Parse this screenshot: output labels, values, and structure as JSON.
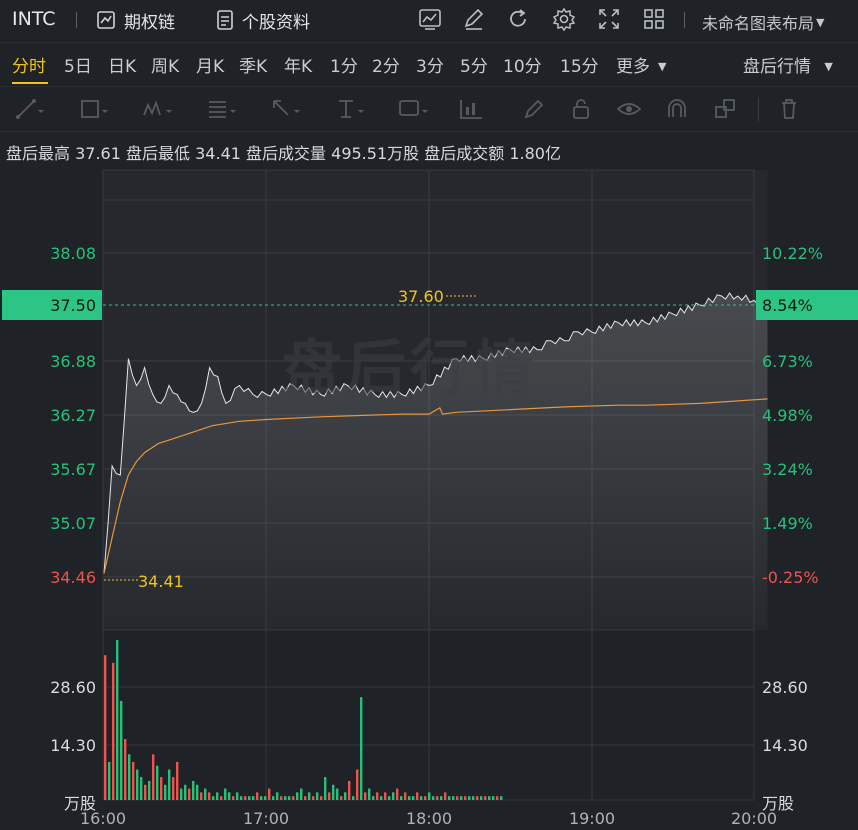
{
  "header": {
    "ticker": "INTC",
    "options_chain": "期权链",
    "stock_profile": "个股资料",
    "layout_name": "未命名图表布局"
  },
  "tabs": [
    "分时",
    "5日",
    "日K",
    "周K",
    "月K",
    "季K",
    "年K",
    "1分",
    "2分",
    "3分",
    "5分",
    "10分",
    "15分",
    "更多"
  ],
  "active_tab": "分时",
  "after_hours_menu": "盘后行情",
  "stats": {
    "high_label": "盘后最高",
    "high_value": "37.61",
    "low_label": "盘后最低",
    "low_value": "34.41",
    "volume_label": "盘后成交量",
    "volume_value": "495.51万股",
    "turnover_label": "盘后成交额",
    "turnover_value": "1.80亿"
  },
  "watermark": "盘后行情",
  "colors": {
    "up": "#27c27a",
    "down": "#f0524e",
    "current": "#2dc585",
    "avg_line": "#e8963c",
    "price_line": "#e6e6e6",
    "highlight": "#f3c21b"
  },
  "chart_data": {
    "type": "line",
    "title": "",
    "x_ticks": [
      "16:00",
      "17:00",
      "18:00",
      "19:00",
      "20:00"
    ],
    "price_axis_left": [
      "38.08",
      "36.88",
      "36.27",
      "35.67",
      "35.07",
      "34.46"
    ],
    "pct_axis_right": [
      "10.22%",
      "6.73%",
      "4.98%",
      "3.24%",
      "1.49%",
      "-0.25%"
    ],
    "current_price": "37.50",
    "current_pct": "8.54%",
    "high_marker": "37.60",
    "low_marker": "34.41",
    "ylim": [
      34.46,
      38.08
    ],
    "volume_ticks": [
      "28.60",
      "14.30"
    ],
    "volume_unit": "万股",
    "price_series": {
      "name": "price",
      "time_minutes": [
        0,
        3,
        6,
        9,
        12,
        15,
        18,
        21,
        24,
        27,
        30,
        33,
        36,
        39,
        42,
        45,
        50,
        55,
        60,
        70,
        80,
        90,
        100,
        110,
        120,
        130,
        140,
        150,
        160,
        165,
        170,
        175,
        180,
        190,
        200,
        210,
        220,
        228,
        234,
        240,
        245
      ],
      "values": [
        34.5,
        35.7,
        35.6,
        36.9,
        36.6,
        36.8,
        36.5,
        36.4,
        36.6,
        36.5,
        36.4,
        36.3,
        36.4,
        36.8,
        36.7,
        36.4,
        36.6,
        36.5,
        36.5,
        36.6,
        36.5,
        36.6,
        36.5,
        36.5,
        36.6,
        36.9,
        36.9,
        37.0,
        37.0,
        37.1,
        37.1,
        37.2,
        37.2,
        37.3,
        37.3,
        37.4,
        37.5,
        37.6,
        37.6,
        37.55,
        37.5
      ]
    },
    "avg_series": {
      "name": "avg",
      "time_minutes": [
        0,
        3,
        6,
        9,
        12,
        15,
        20,
        25,
        30,
        35,
        40,
        50,
        60,
        80,
        100,
        110,
        120,
        124,
        125,
        130,
        150,
        170,
        190,
        200,
        210,
        220,
        230,
        245
      ],
      "values": [
        34.5,
        34.9,
        35.3,
        35.6,
        35.75,
        35.85,
        35.95,
        36.0,
        36.05,
        36.1,
        36.15,
        36.2,
        36.22,
        36.25,
        36.27,
        36.28,
        36.28,
        36.35,
        36.28,
        36.3,
        36.33,
        36.36,
        36.38,
        36.38,
        36.39,
        36.4,
        36.42,
        36.45
      ]
    },
    "volume_series": {
      "name": "volume",
      "values": [
        38,
        10,
        36,
        42,
        26,
        16,
        12,
        10,
        8,
        6,
        4,
        5,
        12,
        9,
        6,
        4,
        8,
        6,
        10,
        3,
        4,
        3,
        5,
        4,
        2,
        3,
        2,
        1,
        2,
        1,
        3,
        2,
        1,
        2,
        1,
        1,
        1,
        1,
        2,
        1,
        1,
        3,
        1,
        2,
        1,
        1,
        1,
        1,
        2,
        3,
        1,
        2,
        1,
        2,
        1,
        6,
        2,
        4,
        3,
        1,
        2,
        5,
        1,
        8,
        27,
        2,
        3,
        1,
        2,
        1,
        2,
        1,
        2,
        3,
        1,
        2,
        1,
        1,
        2,
        1,
        1,
        2,
        1,
        1,
        1,
        2,
        1,
        1,
        1,
        1,
        1,
        1,
        1,
        1,
        1,
        1,
        1,
        1,
        1,
        1
      ],
      "up_flags": [
        0,
        1,
        0,
        1,
        1,
        0,
        1,
        0,
        1,
        1,
        0,
        1,
        0,
        1,
        0,
        1,
        1,
        0,
        0,
        1,
        1,
        0,
        1,
        1,
        0,
        1,
        0,
        1,
        1,
        0,
        1,
        1,
        0,
        1,
        1,
        0,
        1,
        1,
        0,
        1,
        1,
        0,
        1,
        1,
        0,
        1,
        1,
        0,
        1,
        1,
        0,
        1,
        0,
        1,
        0,
        1,
        0,
        1,
        1,
        0,
        1,
        0,
        1,
        0,
        1,
        0,
        1,
        1,
        0,
        1,
        0,
        1,
        1,
        0,
        1,
        0,
        1,
        1,
        0,
        1,
        0,
        1,
        1,
        0,
        1,
        0,
        1,
        1,
        0,
        1,
        0,
        1,
        1,
        0,
        1,
        0,
        1,
        1,
        0,
        1
      ]
    }
  }
}
